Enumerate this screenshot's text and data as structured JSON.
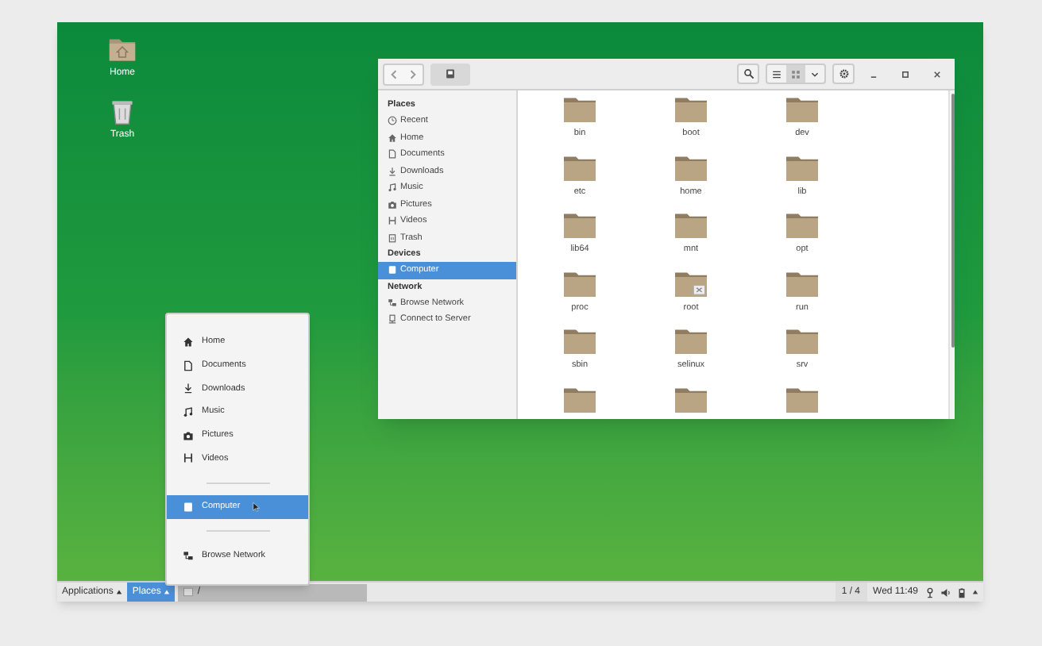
{
  "desktop_icons": [
    {
      "label": "Home",
      "kind": "home"
    },
    {
      "label": "Trash",
      "kind": "trash"
    }
  ],
  "file_manager": {
    "view_buttons": [
      {
        "kind": "list",
        "selected": false
      },
      {
        "kind": "grid",
        "selected": true
      }
    ],
    "sidebar": [
      {
        "heading": "Places",
        "items": [
          {
            "label": "Recent",
            "selected": false
          },
          {
            "label": "Home",
            "selected": false
          },
          {
            "label": "Documents",
            "selected": false
          },
          {
            "label": "Downloads",
            "selected": false
          },
          {
            "label": "Music",
            "selected": false
          },
          {
            "label": "Pictures",
            "selected": false
          },
          {
            "label": "Videos",
            "selected": false
          },
          {
            "label": "Trash",
            "selected": false
          }
        ]
      },
      {
        "heading": "Devices",
        "items": [
          {
            "label": "Computer",
            "selected": true
          }
        ]
      },
      {
        "heading": "Network",
        "items": [
          {
            "label": "Browse Network",
            "selected": false
          },
          {
            "label": "Connect to Server",
            "selected": false
          }
        ]
      }
    ],
    "files": [
      {
        "name": "bin",
        "emblem": false
      },
      {
        "name": "boot",
        "emblem": false
      },
      {
        "name": "dev",
        "emblem": false
      },
      {
        "name": "etc",
        "emblem": false
      },
      {
        "name": "home",
        "emblem": false
      },
      {
        "name": "lib",
        "emblem": false
      },
      {
        "name": "lib64",
        "emblem": false
      },
      {
        "name": "mnt",
        "emblem": false
      },
      {
        "name": "opt",
        "emblem": false
      },
      {
        "name": "proc",
        "emblem": false
      },
      {
        "name": "root",
        "emblem": true
      },
      {
        "name": "run",
        "emblem": false
      },
      {
        "name": "sbin",
        "emblem": false
      },
      {
        "name": "selinux",
        "emblem": false
      },
      {
        "name": "srv",
        "emblem": false
      },
      {
        "emblem": false
      },
      {
        "emblem": false
      },
      {
        "emblem": false
      }
    ]
  },
  "places_menu": [
    {
      "kind": "item",
      "label": "Home",
      "selected": false
    },
    {
      "kind": "item",
      "label": "Documents",
      "selected": false
    },
    {
      "kind": "item",
      "label": "Downloads",
      "selected": false
    },
    {
      "kind": "item",
      "label": "Music",
      "selected": false
    },
    {
      "kind": "item",
      "label": "Pictures",
      "selected": false
    },
    {
      "kind": "item",
      "label": "Videos",
      "selected": false
    },
    {
      "kind": "separator"
    },
    {
      "kind": "item",
      "label": "Computer",
      "selected": true
    },
    {
      "kind": "separator"
    },
    {
      "kind": "item",
      "label": "Browse Network",
      "selected": false
    }
  ],
  "taskbar": {
    "menus": [
      {
        "label": "Applications",
        "selected": false
      },
      {
        "label": "Places",
        "selected": true
      }
    ],
    "window_button": {
      "label": "/"
    },
    "workspace": "1 / 4",
    "clock": "Wed 11:49"
  }
}
